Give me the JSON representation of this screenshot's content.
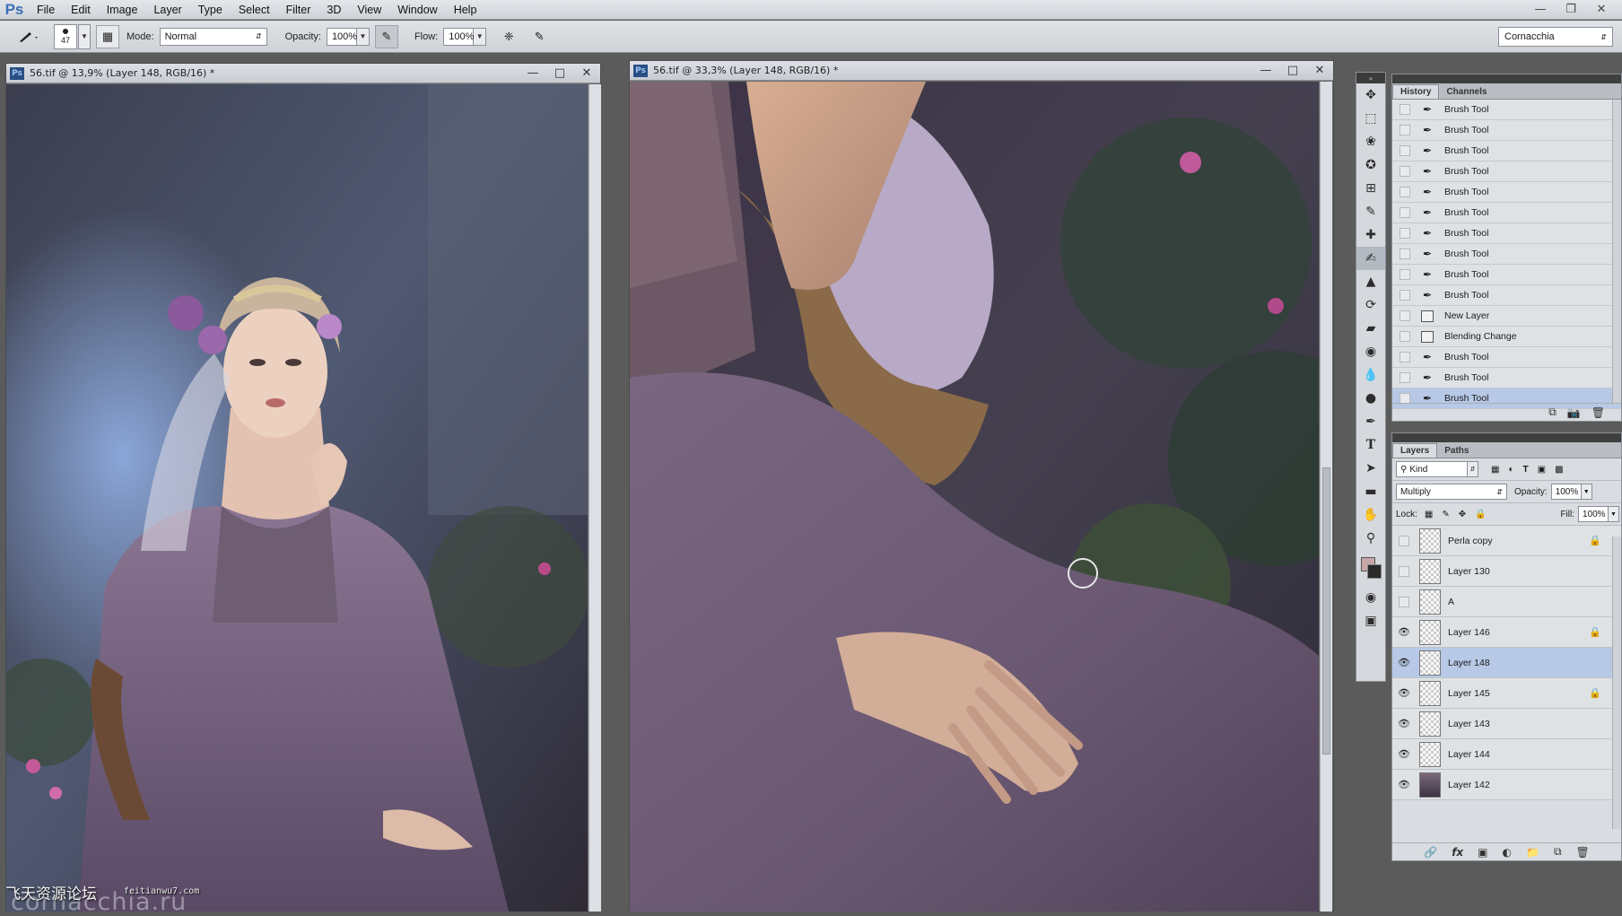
{
  "app": {
    "logo": "Ps"
  },
  "menu": [
    "File",
    "Edit",
    "Image",
    "Layer",
    "Type",
    "Select",
    "Filter",
    "3D",
    "View",
    "Window",
    "Help"
  ],
  "options": {
    "brush_size": "47",
    "mode_label": "Mode:",
    "mode_value": "Normal",
    "opacity_label": "Opacity:",
    "opacity_value": "100%",
    "flow_label": "Flow:",
    "flow_value": "100%",
    "workspace": "Cornacchia"
  },
  "doc_left": {
    "title": "56.tif @ 13,9% (Layer 148, RGB/16) *"
  },
  "doc_right": {
    "title": "56.tif @ 33,3% (Layer 148, RGB/16) *"
  },
  "history": {
    "tabs": [
      "History",
      "Channels"
    ],
    "items": [
      {
        "label": "Brush Tool",
        "icon": "brush-icon"
      },
      {
        "label": "Brush Tool",
        "icon": "brush-icon"
      },
      {
        "label": "Brush Tool",
        "icon": "brush-icon"
      },
      {
        "label": "Brush Tool",
        "icon": "brush-icon"
      },
      {
        "label": "Brush Tool",
        "icon": "brush-icon"
      },
      {
        "label": "Brush Tool",
        "icon": "brush-icon"
      },
      {
        "label": "Brush Tool",
        "icon": "brush-icon"
      },
      {
        "label": "Brush Tool",
        "icon": "brush-icon"
      },
      {
        "label": "Brush Tool",
        "icon": "brush-icon"
      },
      {
        "label": "Brush Tool",
        "icon": "brush-icon"
      },
      {
        "label": "New Layer",
        "icon": "layer-doc-icon"
      },
      {
        "label": "Blending Change",
        "icon": "layer-doc-icon"
      },
      {
        "label": "Brush Tool",
        "icon": "brush-icon"
      },
      {
        "label": "Brush Tool",
        "icon": "brush-icon"
      },
      {
        "label": "Brush Tool",
        "icon": "brush-icon",
        "selected": true
      }
    ]
  },
  "layers": {
    "tabs": [
      "Layers",
      "Paths"
    ],
    "filter_kind": "Kind",
    "blend_mode": "Multiply",
    "opacity_label": "Opacity:",
    "opacity_value": "100%",
    "lock_label": "Lock:",
    "fill_label": "Fill:",
    "fill_value": "100%",
    "items": [
      {
        "name": "Perla copy",
        "visible": false,
        "locked": true
      },
      {
        "name": "Layer 130",
        "visible": false,
        "locked": false
      },
      {
        "name": "A",
        "visible": false,
        "locked": false
      },
      {
        "name": "Layer 146",
        "visible": true,
        "locked": true
      },
      {
        "name": "Layer 148",
        "visible": true,
        "locked": false,
        "selected": true
      },
      {
        "name": "Layer 145",
        "visible": true,
        "locked": true
      },
      {
        "name": "Layer 143",
        "visible": true,
        "locked": false
      },
      {
        "name": "Layer 144",
        "visible": true,
        "locked": false
      },
      {
        "name": "Layer 142",
        "visible": true,
        "locked": false,
        "photo": true
      }
    ]
  },
  "watermark": {
    "cn": "飞天资源论坛",
    "url": "feitianwu7.com",
    "site": "cornacchia.ru"
  }
}
